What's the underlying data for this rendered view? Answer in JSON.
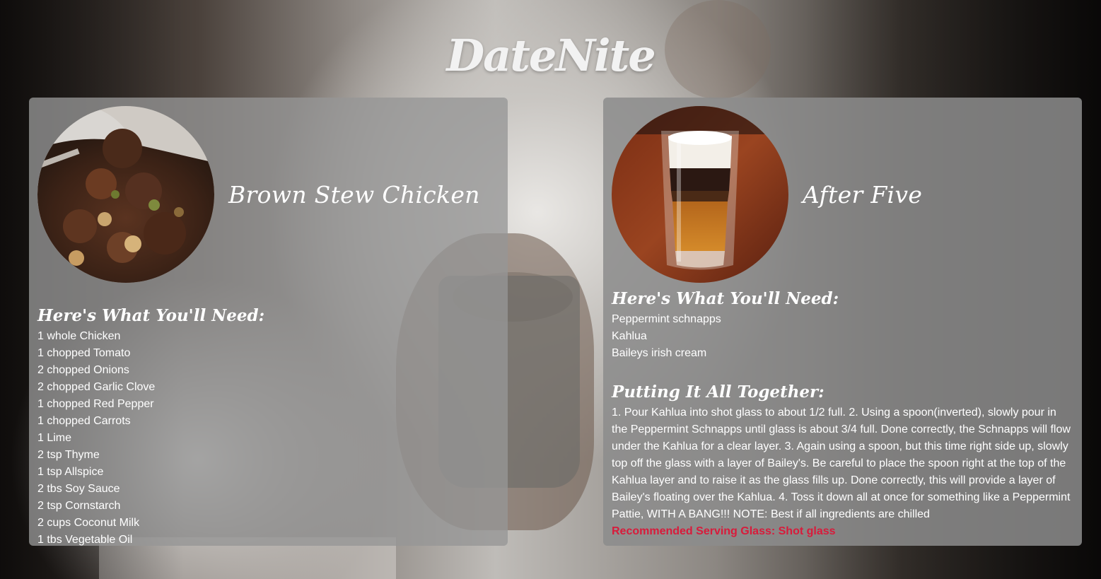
{
  "site": {
    "logo": "DateNite"
  },
  "accent_color": "#d81b3b",
  "food_card": {
    "image_icon": "stew-chicken-photo",
    "title": "Brown Stew Chicken",
    "ingredients_heading": "Here's What You'll Need:",
    "ingredients": [
      "1 whole Chicken",
      "1 chopped Tomato",
      "2 chopped Onions",
      "2 chopped Garlic Clove",
      "1 chopped Red Pepper",
      "1 chopped Carrots",
      "1 Lime",
      "2 tsp Thyme",
      "1 tsp Allspice",
      "2 tbs Soy Sauce",
      "2 tsp Cornstarch",
      "2 cups Coconut Milk",
      "1 tbs Vegetable Oil"
    ]
  },
  "drink_card": {
    "image_icon": "layered-shot-photo",
    "title": "After Five",
    "ingredients_heading": "Here's What You'll Need:",
    "ingredients": [
      "Peppermint schnapps",
      "Kahlua",
      "Baileys irish cream"
    ],
    "directions_heading": "Putting It All Together:",
    "directions": "1. Pour Kahlua into shot glass to about 1/2 full. 2. Using a spoon(inverted), slowly pour in the Peppermint Schnapps until glass is about 3/4 full. Done correctly, the Schnapps will flow under the Kahlua for a clear layer. 3. Again using a spoon, but this time right side up, slowly top off the glass with a layer of Bailey's. Be careful to place the spoon right at the top of the Kahlua layer and to raise it as the glass fills up. Done correctly, this will provide a layer of Bailey's floating over the Kahlua. 4. Toss it down all at once for something like a Peppermint Pattie, WITH A BANG!!! NOTE: Best if all ingredients are chilled",
    "serving_glass": "Recommended Serving Glass: Shot glass"
  }
}
